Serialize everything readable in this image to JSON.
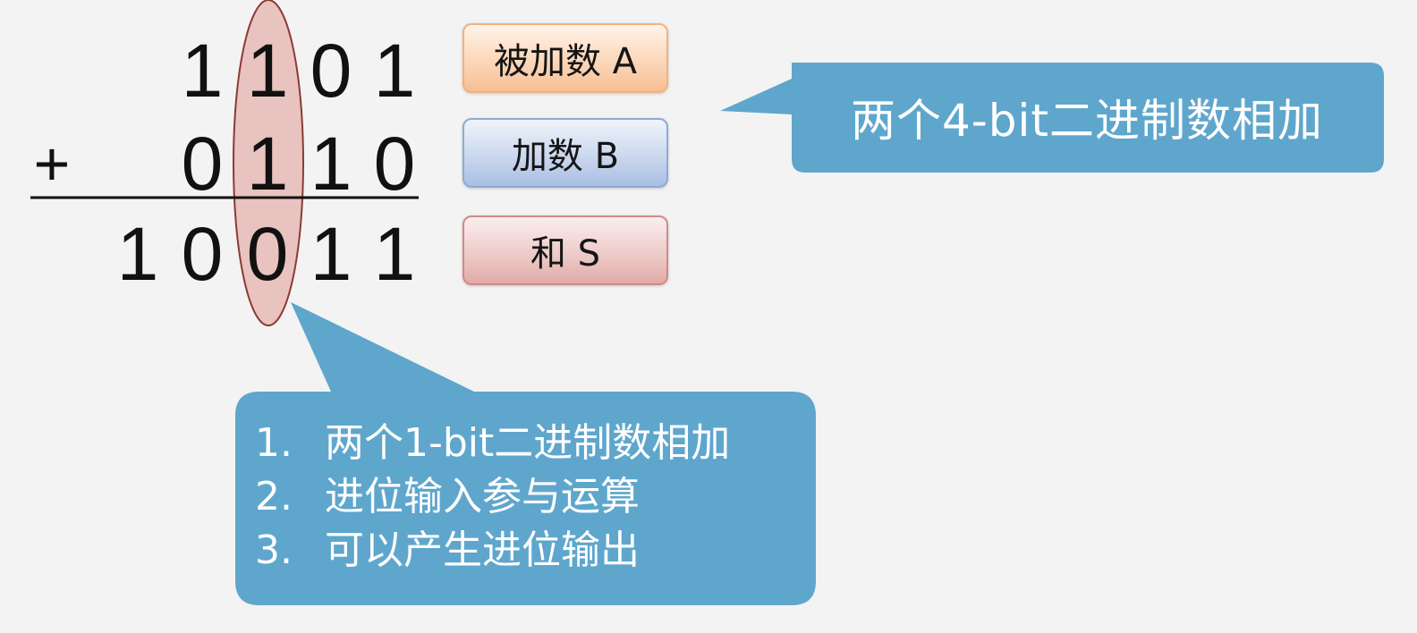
{
  "addition": {
    "row_a": [
      "1",
      "1",
      "0",
      "1"
    ],
    "plus_sign": "+",
    "row_b": [
      "0",
      "1",
      "1",
      "0"
    ],
    "row_sum": [
      "1",
      "0",
      "0",
      "1",
      "1"
    ]
  },
  "labels": {
    "addend_a": "被加数 A",
    "addend_b": "加数 B",
    "sum_s": "和 S"
  },
  "callouts": {
    "top_right": "两个4-bit二进制数相加",
    "bottom_items": [
      {
        "num": "1.",
        "text": "两个1-bit二进制数相加"
      },
      {
        "num": "2.",
        "text": "进位输入参与运算"
      },
      {
        "num": "3.",
        "text": "可以产生进位输出"
      }
    ]
  },
  "colors": {
    "callout_fill": "#5fa6cd",
    "ellipse_fill": "#e6b3ae",
    "ellipse_stroke": "#8b3a34"
  }
}
